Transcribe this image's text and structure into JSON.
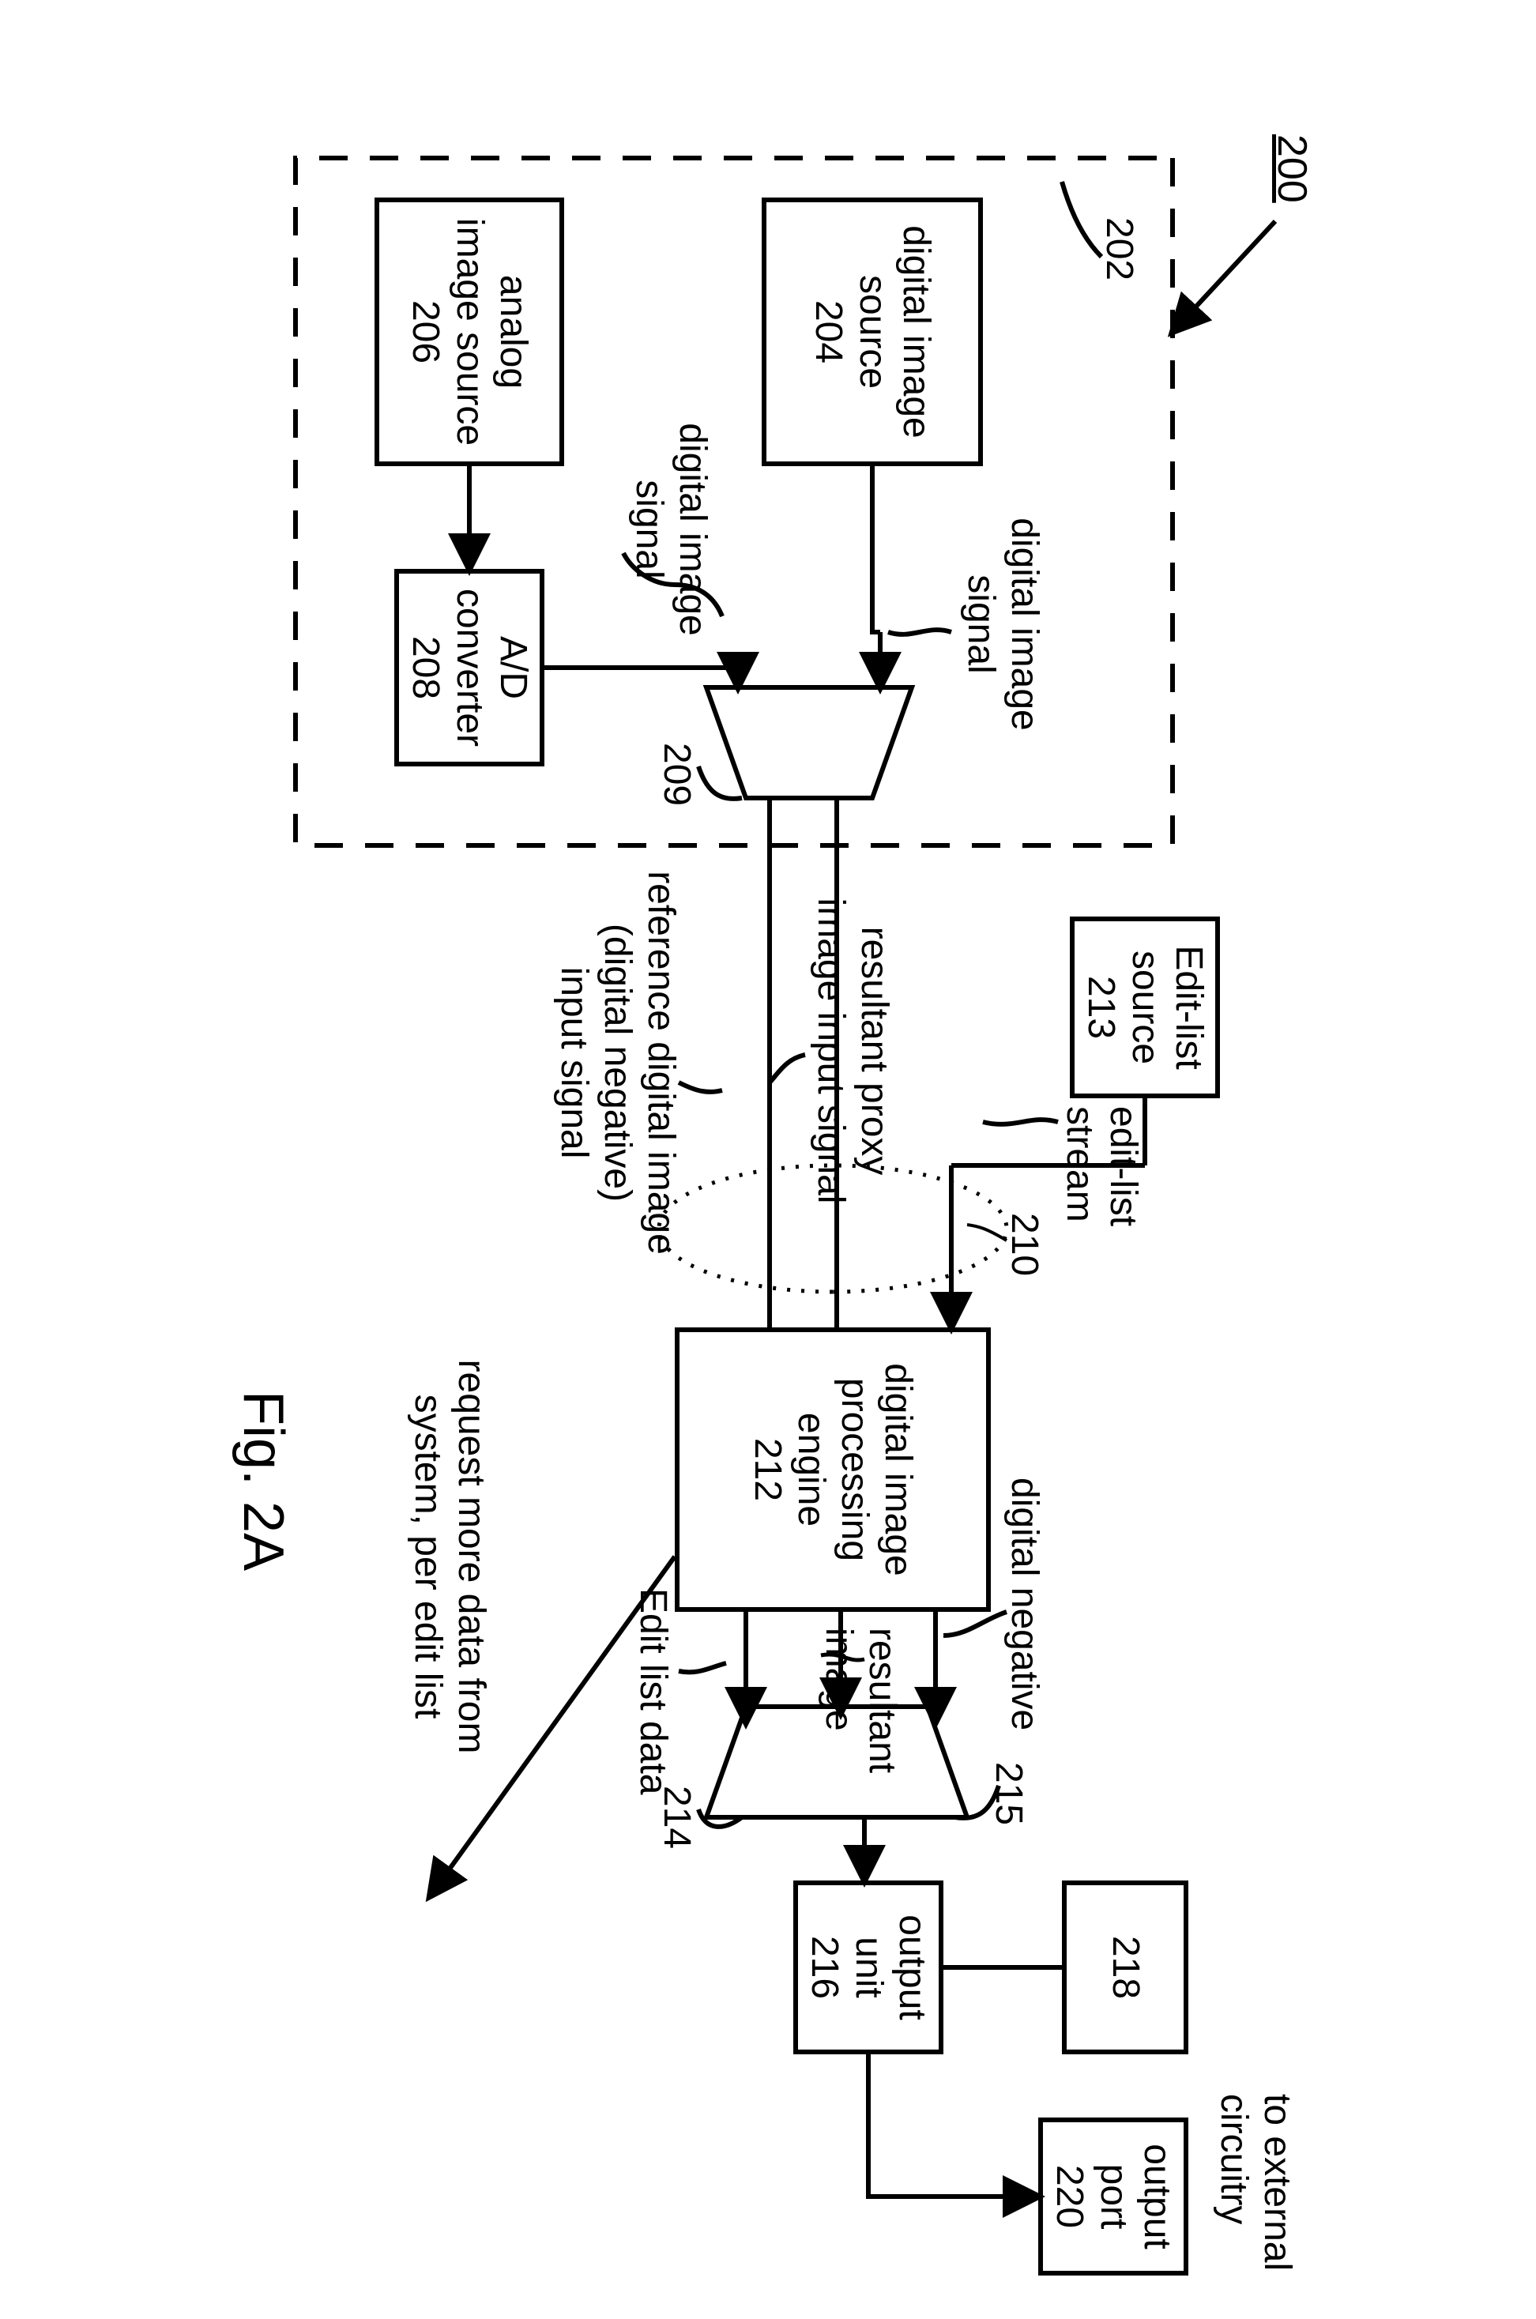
{
  "figure": {
    "title": "Fig. 2A",
    "system_ref": "200"
  },
  "blocks": {
    "digital_image_source": {
      "label": "digital image\nsource\n204",
      "ref_label": "202"
    },
    "analog_image_source": {
      "label": "analog\nimage source\n206"
    },
    "ad_converter": {
      "label": "A/D\nconverter\n208"
    },
    "mux_209_ref": "209",
    "edit_list_source": {
      "label": "Edit-list\nsource\n213"
    },
    "processing_engine": {
      "label": "digital image\nprocessing\nengine\n212"
    },
    "mux_214_ref": "214",
    "mux_215_ref": "215",
    "output_unit": {
      "label": "output\nunit\n216"
    },
    "block_218": {
      "label": "218"
    },
    "output_port": {
      "label": "output\nport\n220"
    }
  },
  "signals": {
    "digital_image_signal_top": "digital image\nsignal",
    "digital_image_signal_bottom": "digital image\nsignal",
    "edit_list_stream": "edit-list\nstream",
    "resultant_proxy": "resultant proxy\nimage input signal",
    "ref_digital_image": "reference digital image\n(digital negative)\ninput signal",
    "group_210": "210",
    "digital_negative": "digital negative",
    "resultant_image": "resultant\nimage",
    "edit_list_data": "Edit list data",
    "to_external": "to external\ncircuitry",
    "request_more": "request more data from\nsystem, per edit list"
  }
}
